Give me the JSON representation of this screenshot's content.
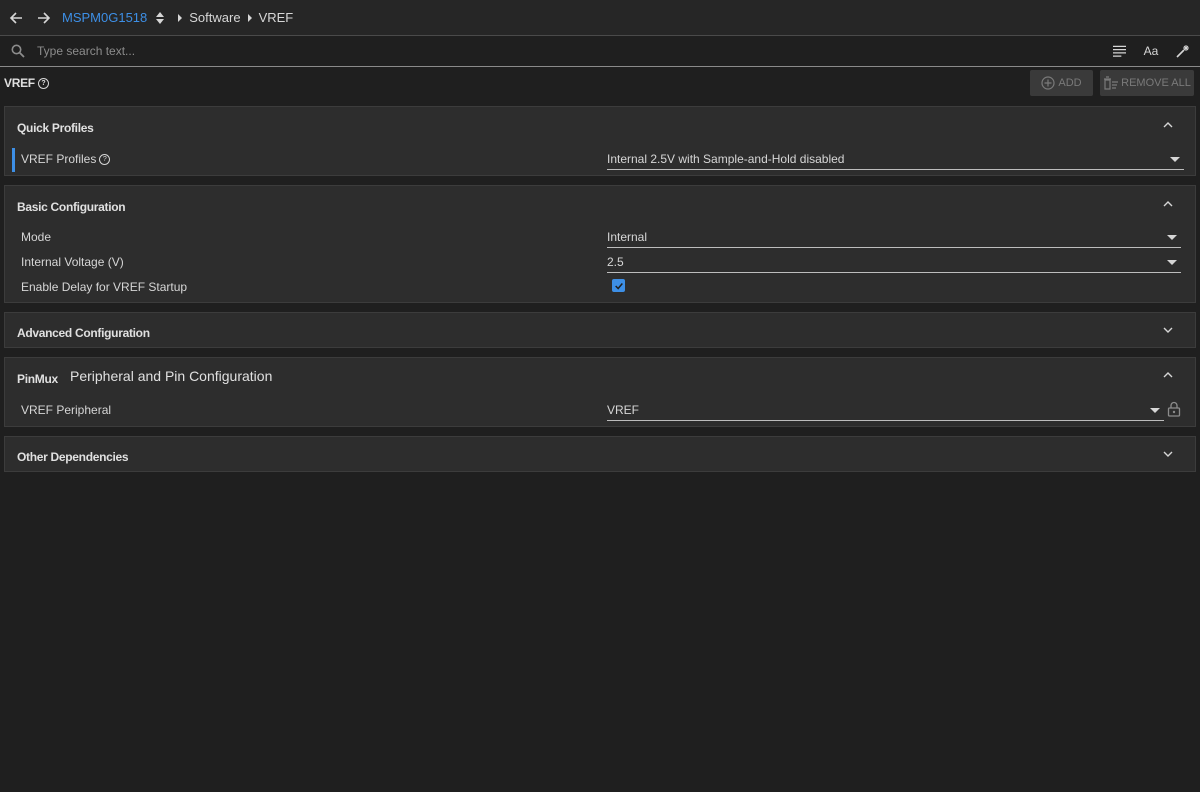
{
  "topbar": {
    "device": "MSPM0G1518",
    "breadcrumb": [
      "Software",
      "VREF"
    ]
  },
  "search": {
    "placeholder": "Type search text..."
  },
  "toolbar": {
    "font_icon_text": "Aa"
  },
  "header": {
    "title": "VREF",
    "help": "?",
    "add_label": "ADD",
    "remove_all_label": "REMOVE ALL"
  },
  "quick_profiles": {
    "title": "Quick Profiles",
    "label": "VREF Profiles",
    "value": "Internal 2.5V with Sample-and-Hold disabled"
  },
  "basic": {
    "title": "Basic Configuration",
    "mode_label": "Mode",
    "mode_value": "Internal",
    "voltage_label": "Internal Voltage (V)",
    "voltage_value": "2.5",
    "delay_label": "Enable Delay for VREF Startup",
    "delay_checked": true
  },
  "advanced": {
    "title": "Advanced Configuration"
  },
  "pinmux": {
    "title": "PinMux",
    "subtitle": "Peripheral and Pin Configuration",
    "peripheral_label": "VREF Peripheral",
    "peripheral_value": "VREF"
  },
  "other": {
    "title": "Other Dependencies"
  },
  "colors": {
    "accent": "#3d8fe6",
    "background": "#1f1f1f",
    "panel": "#2d2d2d"
  }
}
